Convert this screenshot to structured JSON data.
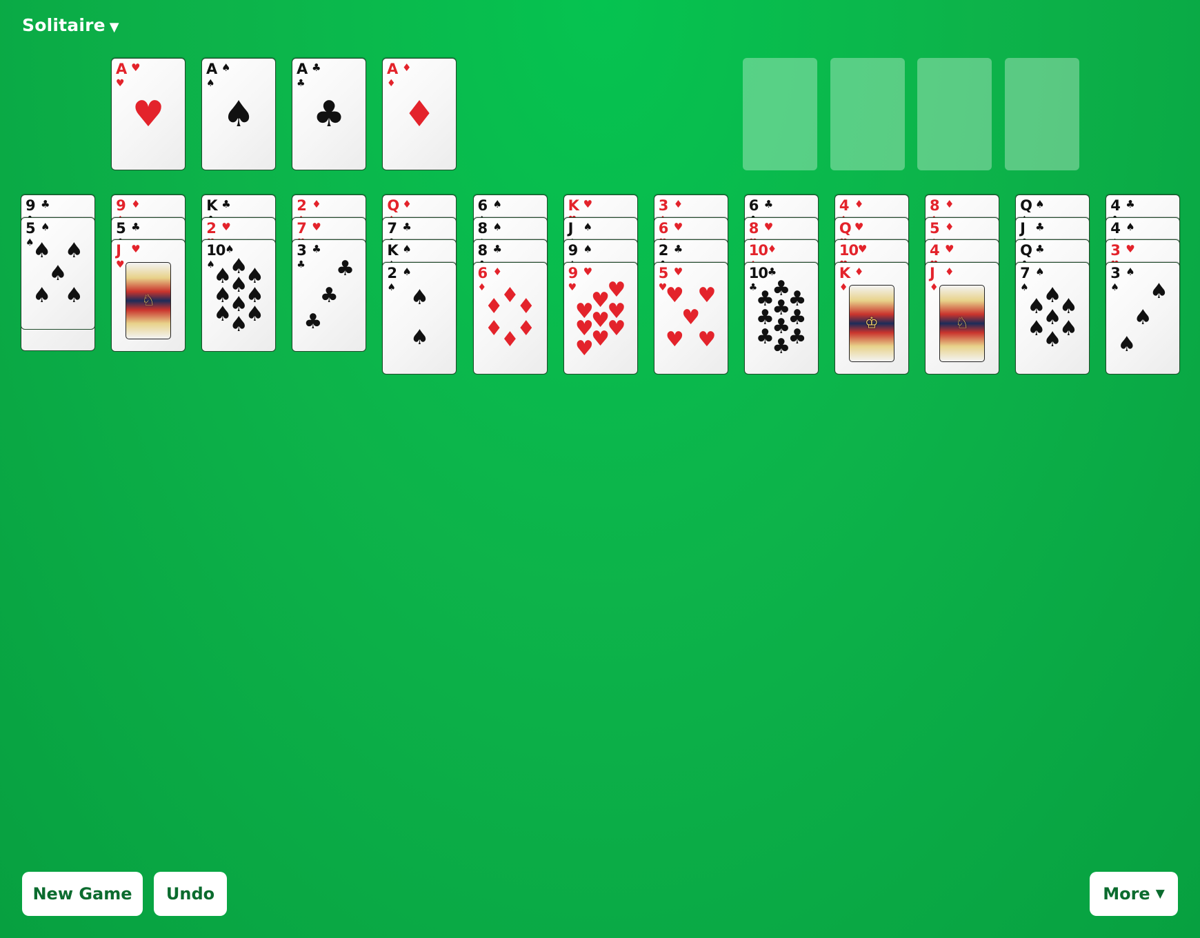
{
  "header": {
    "title": "Solitaire",
    "title_caret": "▼"
  },
  "colors": {
    "red": "#e3232b",
    "black": "#111111",
    "felt": "#0db34a",
    "button_text": "#0b6b2e"
  },
  "foundations": [
    {
      "rank": "A",
      "suit": "hearts",
      "symbol": "♥",
      "color": "red"
    },
    {
      "rank": "A",
      "suit": "spades",
      "symbol": "♠",
      "color": "black"
    },
    {
      "rank": "A",
      "suit": "clubs",
      "symbol": "♣",
      "color": "black"
    },
    {
      "rank": "A",
      "suit": "diamonds",
      "symbol": "♦",
      "color": "red"
    }
  ],
  "free_cells": [
    {
      "state": "empty"
    },
    {
      "state": "empty"
    },
    {
      "state": "empty"
    },
    {
      "state": "empty"
    }
  ],
  "tableau": [
    [
      {
        "rank": "9",
        "suit": "♣"
      },
      {
        "rank": "5",
        "suit": "♠"
      }
    ],
    [
      {
        "rank": "9",
        "suit": "♦"
      },
      {
        "rank": "5",
        "suit": "♣"
      },
      {
        "rank": "J",
        "suit": "♥"
      }
    ],
    [
      {
        "rank": "K",
        "suit": "♣"
      },
      {
        "rank": "2",
        "suit": "♥"
      },
      {
        "rank": "10",
        "suit": "♠"
      }
    ],
    [
      {
        "rank": "2",
        "suit": "♦"
      },
      {
        "rank": "7",
        "suit": "♥"
      },
      {
        "rank": "3",
        "suit": "♣"
      }
    ],
    [
      {
        "rank": "Q",
        "suit": "♦"
      },
      {
        "rank": "7",
        "suit": "♣"
      },
      {
        "rank": "K",
        "suit": "♠"
      },
      {
        "rank": "2",
        "suit": "♠"
      }
    ],
    [
      {
        "rank": "6",
        "suit": "♠"
      },
      {
        "rank": "8",
        "suit": "♠"
      },
      {
        "rank": "8",
        "suit": "♣"
      },
      {
        "rank": "6",
        "suit": "♦"
      }
    ],
    [
      {
        "rank": "K",
        "suit": "♥"
      },
      {
        "rank": "J",
        "suit": "♠"
      },
      {
        "rank": "9",
        "suit": "♠"
      },
      {
        "rank": "9",
        "suit": "♥"
      }
    ],
    [
      {
        "rank": "3",
        "suit": "♦"
      },
      {
        "rank": "6",
        "suit": "♥"
      },
      {
        "rank": "2",
        "suit": "♣"
      },
      {
        "rank": "5",
        "suit": "♥"
      }
    ],
    [
      {
        "rank": "6",
        "suit": "♣"
      },
      {
        "rank": "8",
        "suit": "♥"
      },
      {
        "rank": "10",
        "suit": "♦"
      },
      {
        "rank": "10",
        "suit": "♣"
      }
    ],
    [
      {
        "rank": "4",
        "suit": "♦"
      },
      {
        "rank": "Q",
        "suit": "♥"
      },
      {
        "rank": "10",
        "suit": "♥"
      },
      {
        "rank": "K",
        "suit": "♦"
      }
    ],
    [
      {
        "rank": "8",
        "suit": "♦"
      },
      {
        "rank": "5",
        "suit": "♦"
      },
      {
        "rank": "4",
        "suit": "♥"
      },
      {
        "rank": "J",
        "suit": "♦"
      }
    ],
    [
      {
        "rank": "Q",
        "suit": "♠"
      },
      {
        "rank": "J",
        "suit": "♣"
      },
      {
        "rank": "Q",
        "suit": "♣"
      },
      {
        "rank": "7",
        "suit": "♠"
      }
    ],
    [
      {
        "rank": "4",
        "suit": "♣"
      },
      {
        "rank": "4",
        "suit": "♠"
      },
      {
        "rank": "3",
        "suit": "♥"
      },
      {
        "rank": "3",
        "suit": "♠"
      }
    ]
  ],
  "buttons": {
    "new_game": "New Game",
    "undo": "Undo",
    "more": "More",
    "more_caret": "▼"
  }
}
